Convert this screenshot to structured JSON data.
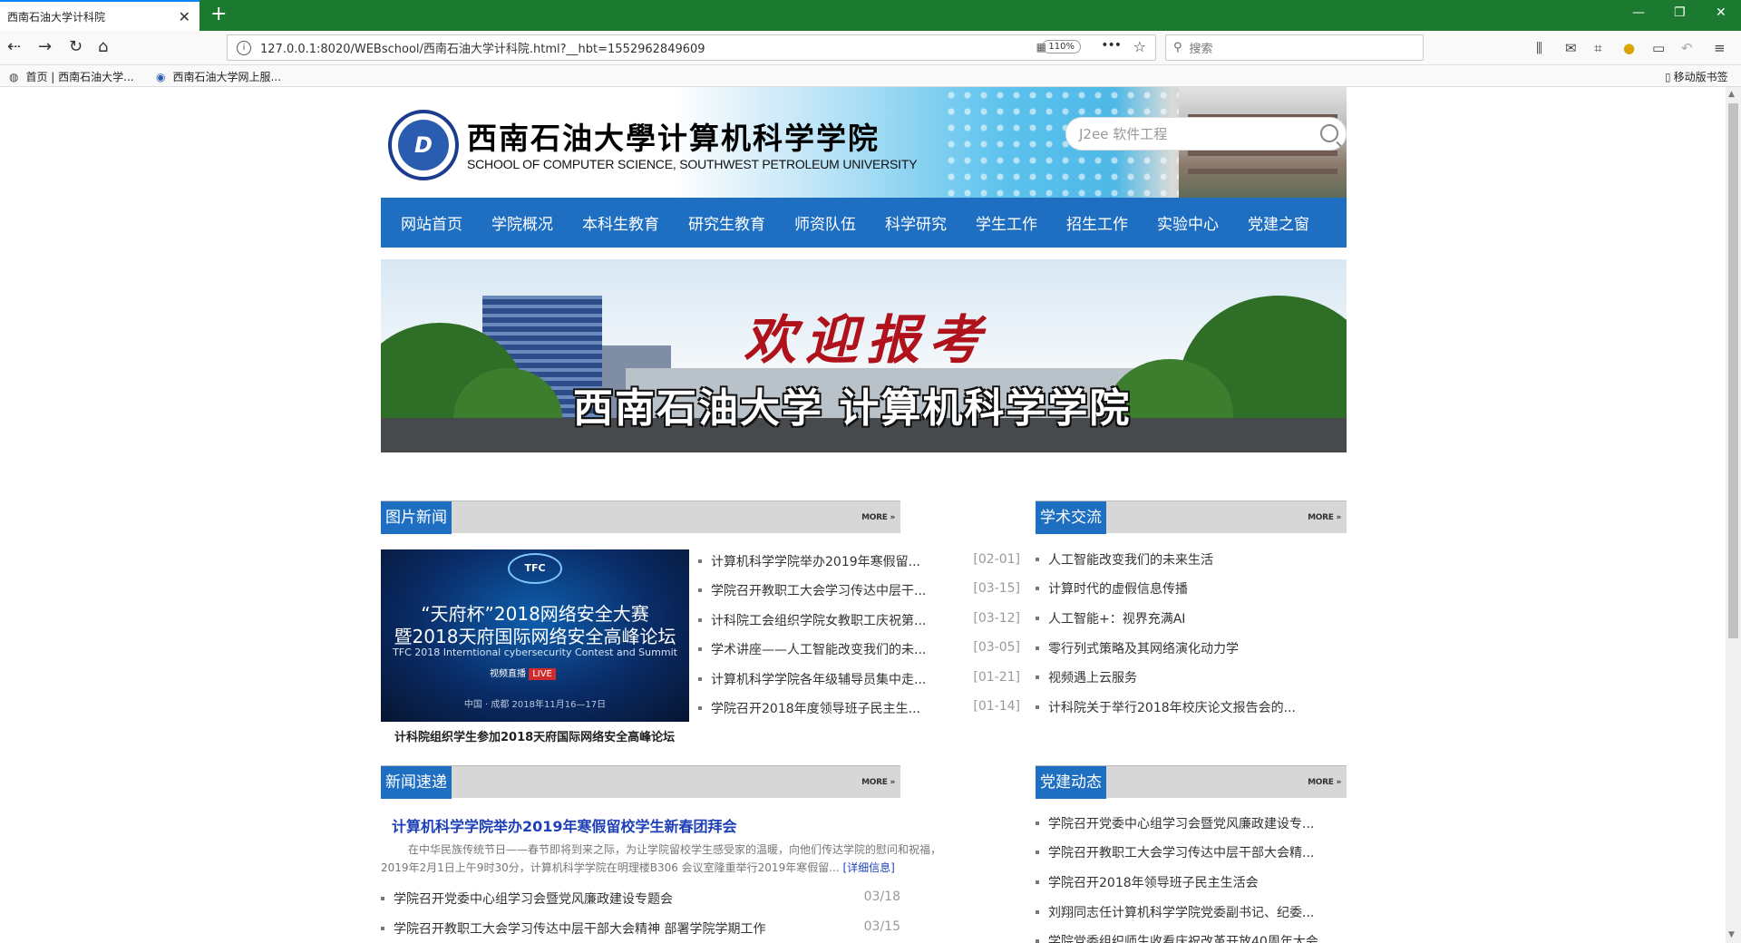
{
  "browser": {
    "tab_title": "西南石油大学计科院",
    "tab_close": "✕",
    "new_tab": "+",
    "url": "127.0.0.1:8020/WEBschool/西南石油大学计科院.html?__hbt=1552962849609",
    "zoom": "110%",
    "search_placeholder": "搜索",
    "bookmarks": [
      "首页 | 西南石油大学...",
      "西南石油大学网上服..."
    ],
    "mobile_bookmarks": "移动版书签"
  },
  "header": {
    "school_name_cn": "西南石油大學计算机科学学院",
    "school_name_en": "SCHOOL OF COMPUTER SCIENCE, SOUTHWEST PETROLEUM UNIVERSITY",
    "search_placeholder": "J2ee 软件工程"
  },
  "nav": {
    "items": [
      "网站首页",
      "学院概况",
      "本科生教育",
      "研究生教育",
      "师资队伍",
      "科学研究",
      "学生工作",
      "招生工作",
      "实验中心",
      "党建之窗"
    ]
  },
  "banner": {
    "welcome": "欢迎报考",
    "title": "西南石油大学 计算机科学学院"
  },
  "more_label": "MORE »",
  "photo_news": {
    "title": "图片新闻",
    "image": {
      "logo": "TFC",
      "line1": "“天府杯”2018网络安全大赛",
      "line2": "暨2018天府国际网络安全高峰论坛",
      "line3": "TFC 2018 Interntional cybersecurity Contest and Summit",
      "live": "视频直播",
      "live_tag": "LIVE",
      "date": "中国 · 成都    2018年11月16—17日"
    },
    "caption": "计科院组织学生参加2018天府国际网络安全高峰论坛",
    "items": [
      {
        "title": "计算机科学学院举办2019年寒假留...",
        "date": "[02-01]"
      },
      {
        "title": "学院召开教职工大会学习传达中层干...",
        "date": "[03-15]"
      },
      {
        "title": "计科院工会组织学院女教职工庆祝第...",
        "date": "[03-12]"
      },
      {
        "title": "学术讲座——人工智能改变我们的未...",
        "date": "[03-05]"
      },
      {
        "title": "计算机科学学院各年级辅导员集中走...",
        "date": "[01-21]"
      },
      {
        "title": "学院召开2018年度领导班子民主生...",
        "date": "[01-14]"
      }
    ]
  },
  "academic": {
    "title": "学术交流",
    "items": [
      "人工智能改变我们的未来生活",
      "计算时代的虚假信息传播",
      "人工智能+：视界充满AI",
      "零行列式策略及其网络演化动力学",
      "视频遇上云服务",
      "计科院关于举行2018年校庆论文报告会的..."
    ]
  },
  "news_fast": {
    "title": "新闻速递",
    "headline": "计算机科学学院举办2019年寒假留校学生新春团拜会",
    "summary_line1": "在中华民族传统节日——春节即将到来之际，为让学院留校学生感受家的温暖，向他们传达学院的慰问和祝福，",
    "summary_line2": "2019年2月1日上午9时30分，计算机科学学院在明理楼B306 会议室隆重举行2019年寒假留...",
    "detail_link": "[详细信息]",
    "items": [
      {
        "title": "学院召开党委中心组学习会暨党风廉政建设专题会",
        "date": "03/18"
      },
      {
        "title": "学院召开教职工大会学习传达中层干部大会精神 部署学院学期工作",
        "date": "03/15"
      }
    ]
  },
  "party": {
    "title": "党建动态",
    "items": [
      "学院召开党委中心组学习会暨党风廉政建设专...",
      "学院召开教职工大会学习传达中层干部大会精...",
      "学院召开2018年领导班子民主生活会",
      "刘翔同志任计算机科学学院党委副书记、纪委...",
      "学院党委组织师生收看庆祝改革开放40周年大会"
    ]
  }
}
